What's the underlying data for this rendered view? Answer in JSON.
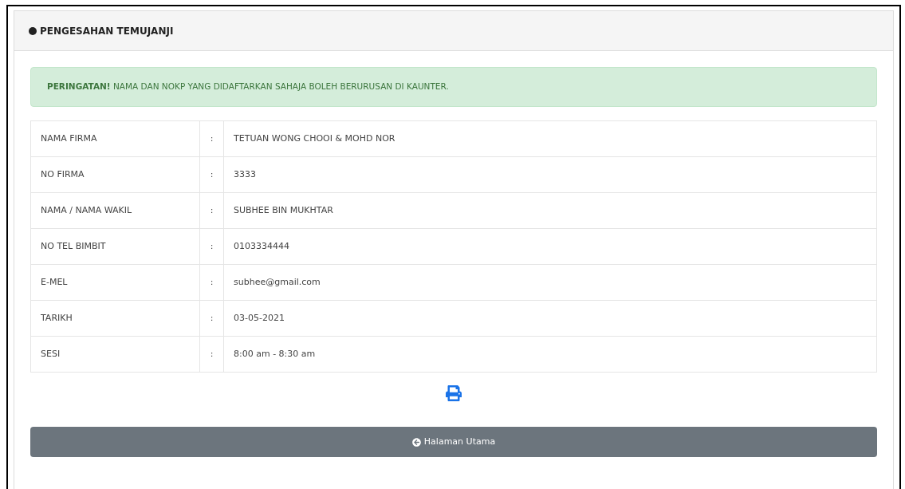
{
  "card": {
    "title": "PENGESAHAN TEMUJANJI"
  },
  "alert": {
    "text": "**PERINGATAN!** NAMA DAN NOKP YANG DIDAFTARKAN SAHAJA BOLEH BERURUSAN DI KAUNTER."
  },
  "table": {
    "rows": [
      {
        "label": "NAMA FIRMA",
        "separator": ":",
        "value": "TETUAN WONG CHOOI & MOHD NOR"
      },
      {
        "label": "NO FIRMA",
        "separator": ":",
        "value": "3333"
      },
      {
        "label": "NAMA / NAMA WAKIL",
        "separator": ":",
        "value": "SUBHEE BIN MUKHTAR"
      },
      {
        "label": "NO TEL BIMBIT",
        "separator": ":",
        "value": "0103334444"
      },
      {
        "label": "E-MEL",
        "separator": ":",
        "value": "subhee@gmail.com"
      },
      {
        "label": "TARIKH",
        "separator": ":",
        "value": "03-05-2021"
      },
      {
        "label": "SESI",
        "separator": ":",
        "value": "8:00 am - 8:30 am"
      }
    ]
  },
  "home_button": {
    "label": "Halaman Utama"
  }
}
